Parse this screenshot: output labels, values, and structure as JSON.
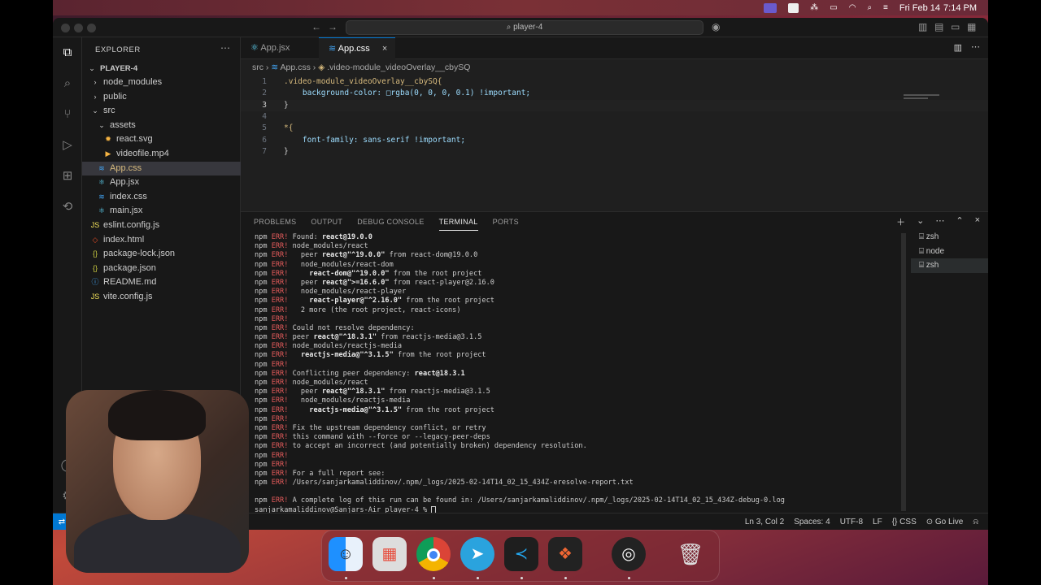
{
  "menubar": {
    "date": "Fri Feb 14",
    "time": "7:14 PM"
  },
  "window": {
    "search": "player-4"
  },
  "explorer": {
    "title": "EXPLORER",
    "project": "PLAYER-4",
    "items": [
      {
        "label": "node_modules",
        "icon": "chevron-right",
        "depth": 1
      },
      {
        "label": "public",
        "icon": "chevron-right",
        "depth": 1
      },
      {
        "label": "src",
        "icon": "chevron-down",
        "depth": 1
      },
      {
        "label": "assets",
        "icon": "chevron-down",
        "depth": 2
      },
      {
        "label": "react.svg",
        "icon": "svg-file",
        "depth": 3
      },
      {
        "label": "videofile.mp4",
        "icon": "video-file",
        "depth": 3
      },
      {
        "label": "App.css",
        "icon": "css-file",
        "depth": 2,
        "selected": true
      },
      {
        "label": "App.jsx",
        "icon": "react-file",
        "depth": 2
      },
      {
        "label": "index.css",
        "icon": "css-file",
        "depth": 2
      },
      {
        "label": "main.jsx",
        "icon": "react-file",
        "depth": 2
      },
      {
        "label": "eslint.config.js",
        "icon": "js-file",
        "depth": 1
      },
      {
        "label": "index.html",
        "icon": "html-file",
        "depth": 1
      },
      {
        "label": "package-lock.json",
        "icon": "json-file",
        "depth": 1
      },
      {
        "label": "package.json",
        "icon": "json-file",
        "depth": 1
      },
      {
        "label": "README.md",
        "icon": "info-file",
        "depth": 1
      },
      {
        "label": "vite.config.js",
        "icon": "js-file",
        "depth": 1
      }
    ]
  },
  "tabs": [
    {
      "label": "App.jsx",
      "active": false
    },
    {
      "label": "App.css",
      "active": true
    }
  ],
  "breadcrumb": {
    "folder": "src",
    "file": "App.css",
    "symbol": ".video-module_videoOverlay__cbySQ"
  },
  "code": [
    {
      "n": "1",
      "text": ".video-module_videoOverlay__cbySQ{"
    },
    {
      "n": "2",
      "text": "    background-color: □rgba(0, 0, 0, 0.1) !important;"
    },
    {
      "n": "3",
      "text": "}"
    },
    {
      "n": "4",
      "text": ""
    },
    {
      "n": "5",
      "text": "*{"
    },
    {
      "n": "6",
      "text": "    font-family: sans-serif !important;"
    },
    {
      "n": "7",
      "text": "}"
    }
  ],
  "panel_tabs": [
    "PROBLEMS",
    "OUTPUT",
    "DEBUG CONSOLE",
    "TERMINAL",
    "PORTS"
  ],
  "terminal_lines": [
    [
      "npm ",
      "ERR!",
      " Found: ",
      "react@19.0.0",
      ""
    ],
    [
      "npm ",
      "ERR!",
      " node_modules/react",
      "",
      ""
    ],
    [
      "npm ",
      "ERR!",
      "   peer ",
      "react@\"^19.0.0\"",
      " from react-dom@19.0.0"
    ],
    [
      "npm ",
      "ERR!",
      "   node_modules/react-dom",
      "",
      ""
    ],
    [
      "npm ",
      "ERR!",
      "     ",
      "react-dom@\"^19.0.0\"",
      " from the root project"
    ],
    [
      "npm ",
      "ERR!",
      "   peer ",
      "react@\">=16.6.0\"",
      " from react-player@2.16.0"
    ],
    [
      "npm ",
      "ERR!",
      "   node_modules/react-player",
      "",
      ""
    ],
    [
      "npm ",
      "ERR!",
      "     ",
      "react-player@\"^2.16.0\"",
      " from the root project"
    ],
    [
      "npm ",
      "ERR!",
      "   2 more (the root project, react-icons)",
      "",
      ""
    ],
    [
      "npm ",
      "ERR!",
      "",
      "",
      ""
    ],
    [
      "npm ",
      "ERR!",
      " Could not resolve dependency:",
      "",
      ""
    ],
    [
      "npm ",
      "ERR!",
      " peer ",
      "react@\"^18.3.1\"",
      " from reactjs-media@3.1.5"
    ],
    [
      "npm ",
      "ERR!",
      " node_modules/reactjs-media",
      "",
      ""
    ],
    [
      "npm ",
      "ERR!",
      "   ",
      "reactjs-media@\"^3.1.5\"",
      " from the root project"
    ],
    [
      "npm ",
      "ERR!",
      "",
      "",
      ""
    ],
    [
      "npm ",
      "ERR!",
      " Conflicting peer dependency: ",
      "react@18.3.1",
      ""
    ],
    [
      "npm ",
      "ERR!",
      " node_modules/react",
      "",
      ""
    ],
    [
      "npm ",
      "ERR!",
      "   peer ",
      "react@\"^18.3.1\"",
      " from reactjs-media@3.1.5"
    ],
    [
      "npm ",
      "ERR!",
      "   node_modules/reactjs-media",
      "",
      ""
    ],
    [
      "npm ",
      "ERR!",
      "     ",
      "reactjs-media@\"^3.1.5\"",
      " from the root project"
    ],
    [
      "npm ",
      "ERR!",
      "",
      "",
      ""
    ],
    [
      "npm ",
      "ERR!",
      " Fix the upstream dependency conflict, or retry",
      "",
      ""
    ],
    [
      "npm ",
      "ERR!",
      " this command with --force or --legacy-peer-deps",
      "",
      ""
    ],
    [
      "npm ",
      "ERR!",
      " to accept an incorrect (and potentially broken) dependency resolution.",
      "",
      ""
    ],
    [
      "npm ",
      "ERR!",
      "",
      "",
      ""
    ],
    [
      "npm ",
      "ERR!",
      "",
      "",
      ""
    ],
    [
      "npm ",
      "ERR!",
      " For a full report see:",
      "",
      ""
    ],
    [
      "npm ",
      "ERR!",
      " /Users/sanjarkamaliddinov/.npm/_logs/2025-02-14T14_02_15_434Z-eresolve-report.txt",
      "",
      ""
    ],
    [
      "",
      "",
      "",
      "",
      ""
    ],
    [
      "npm ",
      "ERR!",
      " A complete log of this run can be found in: /Users/sanjarkamaliddinov/.npm/_logs/2025-02-14T14_02_15_434Z-debug-0.log",
      "",
      ""
    ],
    [
      "sanjarkamaliddinov@Sanjars-Air player-4 % ",
      "",
      "",
      "",
      ""
    ]
  ],
  "terminal_list": [
    "zsh",
    "node",
    "zsh"
  ],
  "status": {
    "position": "Ln 3, Col 2",
    "spaces": "Spaces: 4",
    "encoding": "UTF-8",
    "eol": "LF",
    "language": "CSS",
    "golive": "Go Live"
  },
  "dock": [
    "finder",
    "launchpad",
    "chrome",
    "telegram",
    "vscode",
    "davinci-resolve",
    "obs",
    "trash"
  ]
}
